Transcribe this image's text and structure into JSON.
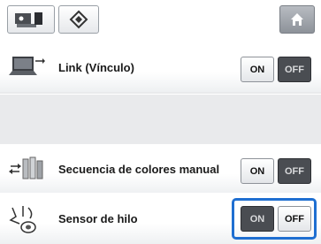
{
  "toolbar": {
    "machine_icon": "machine-settings-icon",
    "settings_icon": "diamond-settings-icon",
    "home_icon": "home-icon"
  },
  "rows": [
    {
      "icon": "link-computer-icon",
      "label": "Link (Vínculo)",
      "on_label": "ON",
      "off_label": "OFF",
      "selected": "off"
    },
    {
      "icon": "color-sequence-icon",
      "label": "Secuencia de colores manual",
      "on_label": "ON",
      "off_label": "OFF",
      "selected": "off"
    },
    {
      "icon": "thread-sensor-icon",
      "label": "Sensor de hilo",
      "on_label": "ON",
      "off_label": "OFF",
      "selected": "on"
    }
  ],
  "colors": {
    "highlight": "#1f6fd1",
    "selected_button": "#4a4d52"
  }
}
